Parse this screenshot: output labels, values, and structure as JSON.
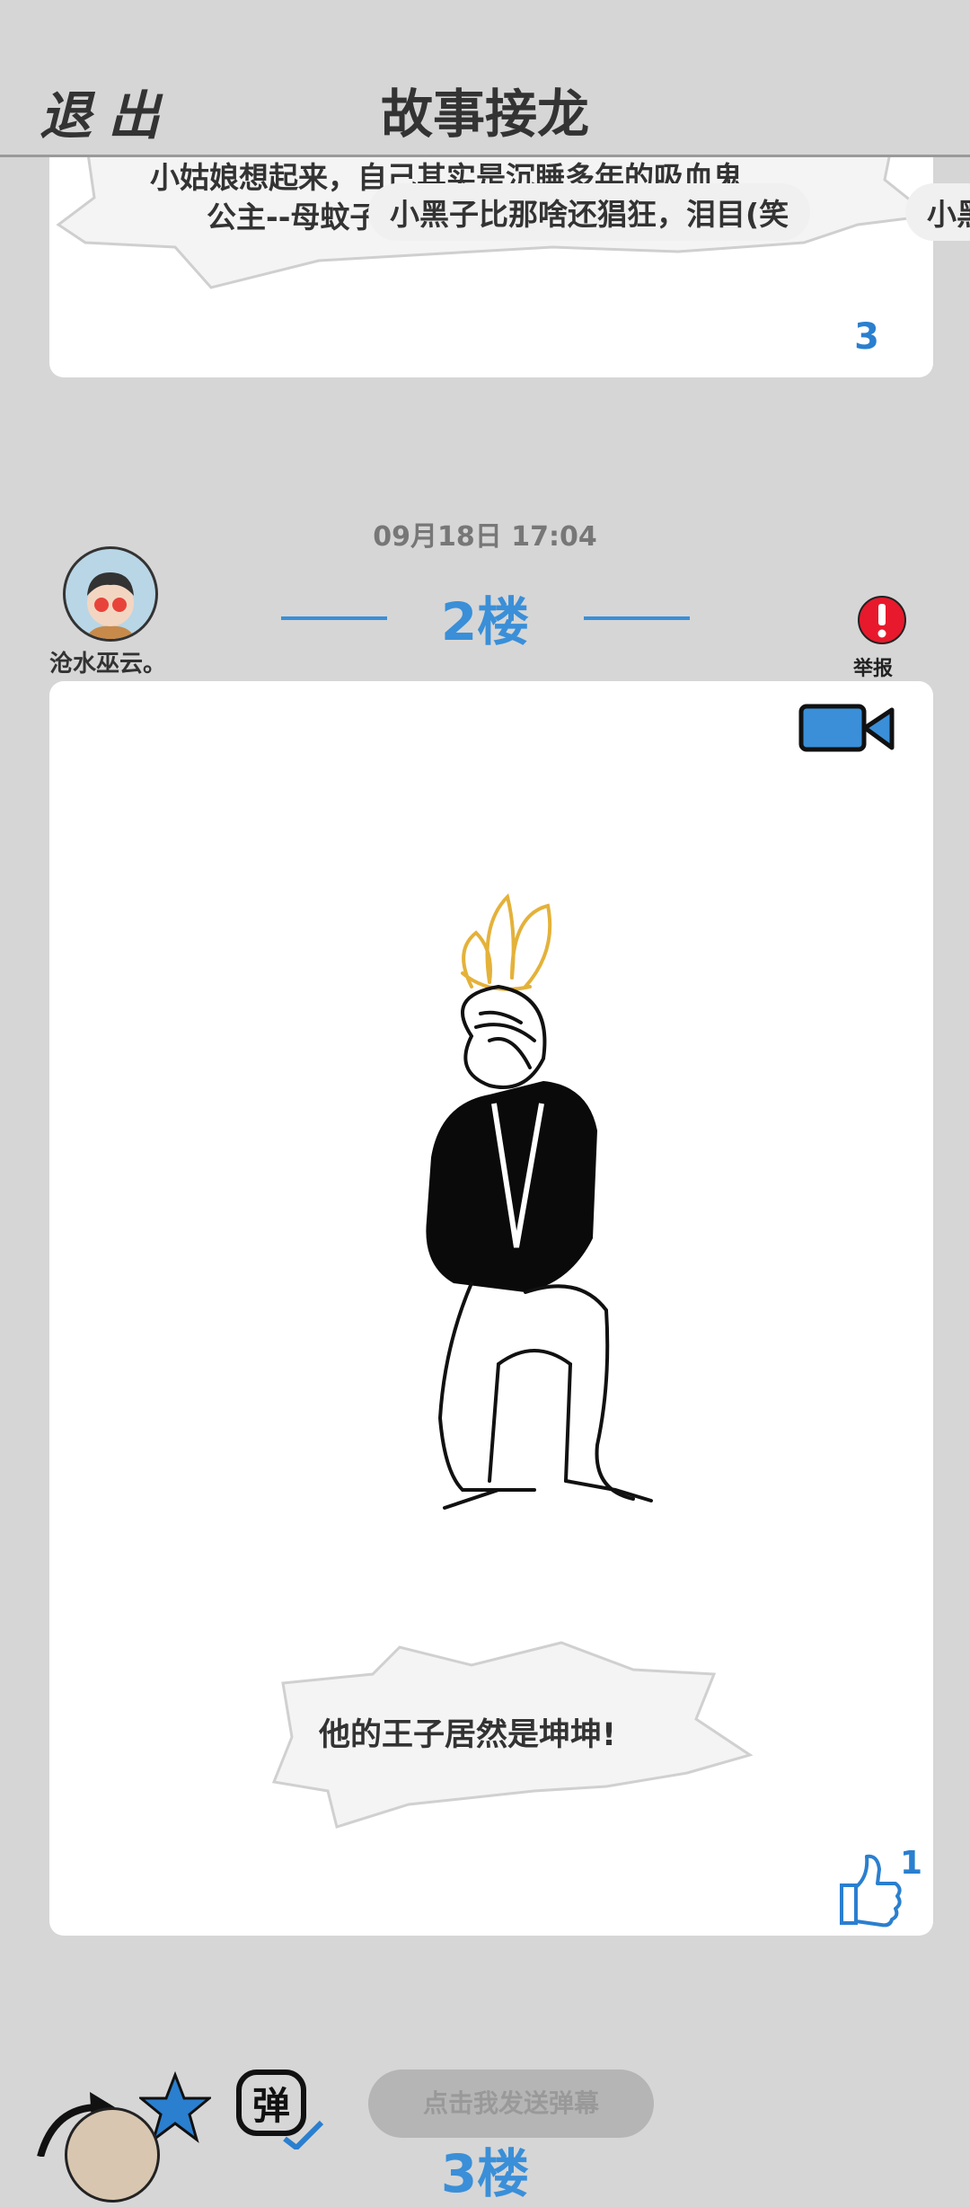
{
  "header": {
    "exit_label": "退出",
    "title": "故事接龙"
  },
  "previous_card": {
    "bubble_text_line1": "小姑娘想起来，自己其实是沉睡多年的吸血鬼",
    "bubble_text_line2": "公主--母蚊子",
    "like_count": "3"
  },
  "danmaku": [
    {
      "text": "小黑子比那啥还猖狂，泪目(笑"
    },
    {
      "text": "小黑"
    }
  ],
  "post": {
    "timestamp": "09月18日  17:04",
    "username": "沧水巫云。",
    "floor_label": "2楼",
    "report_label": "举报",
    "caption": "他的王子居然是坤坤!",
    "like_count": "1"
  },
  "bottom": {
    "send_button_label": "点击我发送弹幕",
    "next_floor_partial": "3楼"
  },
  "colors": {
    "background": "#d6d6d6",
    "accent_blue": "#3a8fd8",
    "report_red": "#e8192c",
    "crown_gold": "#e4b23a"
  }
}
